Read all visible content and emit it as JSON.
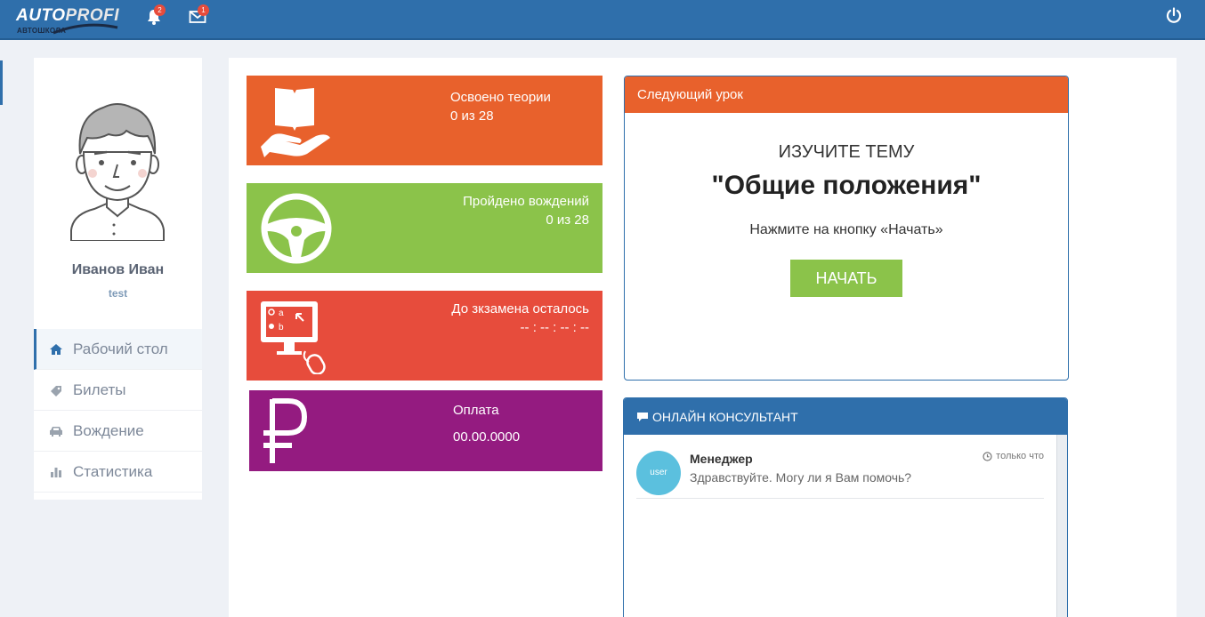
{
  "brand": {
    "name_part1": "AUTO",
    "name_part2": "PROFI",
    "subtitle": "АВТОШКОЛА"
  },
  "header": {
    "notifications_count": "2",
    "messages_count": "1",
    "icons": [
      "bell-icon",
      "envelope-icon",
      "power-icon"
    ]
  },
  "user": {
    "name": "Иванов Иван",
    "role": "test"
  },
  "sidebar": {
    "items": [
      {
        "label": "Рабочий стол",
        "icon": "home-icon",
        "active": true
      },
      {
        "label": "Билеты",
        "icon": "tag-icon",
        "active": false
      },
      {
        "label": "Вождение",
        "icon": "car-icon",
        "active": false
      },
      {
        "label": "Статистика",
        "icon": "bar-chart-icon",
        "active": false
      }
    ]
  },
  "tiles": {
    "theory": {
      "title": "Освоено теории",
      "value": "0 из 28",
      "color": "#e8612c",
      "icon": "book-hand-icon"
    },
    "driving": {
      "title": "Пройдено вождений",
      "value": "0 из 28",
      "color": "#8bc34a",
      "icon": "steering-wheel-icon"
    },
    "exam": {
      "title": "До зкзамена осталось",
      "value": "-- : -- : -- : --",
      "color": "#e74c3c",
      "icon": "computer-test-icon"
    },
    "payment": {
      "title": "Оплата",
      "value": "00.00.0000",
      "color": "#941b80",
      "icon": "ruble-icon"
    }
  },
  "next_lesson": {
    "header": "Следующий урок",
    "kicker": "ИЗУЧИТЕ ТЕМУ",
    "topic": "\"Общие положения\"",
    "hint": "Нажмите на кнопку «Начать»",
    "button_label": "НАЧАТЬ"
  },
  "chat": {
    "header": "ОНЛАЙН КОНСУЛЬТАНТ",
    "messages": [
      {
        "avatar_text": "user",
        "author": "Менеджер",
        "text": "Здравствуйте. Могу ли я Вам помочь?",
        "time": "только что"
      }
    ]
  }
}
